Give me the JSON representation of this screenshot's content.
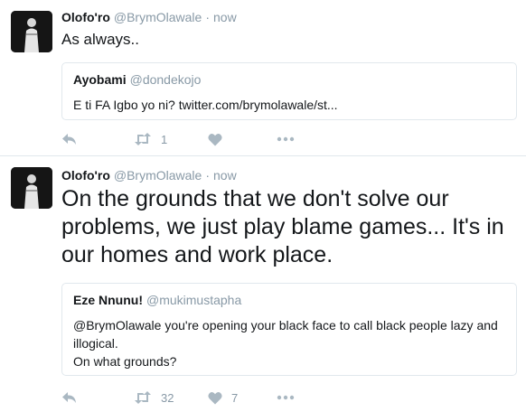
{
  "tweets": [
    {
      "author": {
        "name": "Olofo'ro",
        "handle": "@BrymOlawale"
      },
      "separator": "·",
      "time": "now",
      "text": "As always..",
      "quote": {
        "name": "Ayobami",
        "handle": "@dondekojo",
        "text": "E ti FA Igbo yo ni?  twitter.com/brymolawale/st..."
      },
      "actions": {
        "retweet_count": "1",
        "like_count": ""
      }
    },
    {
      "author": {
        "name": "Olofo'ro",
        "handle": "@BrymOlawale"
      },
      "separator": "·",
      "time": "now",
      "text": "On the grounds that we don't solve our problems, we just play blame games... It's in our homes and work place.",
      "quote": {
        "name": "Eze Nnunu!",
        "handle": "@mukimustapha",
        "text": "@BrymOlawale you're opening your black face to call black people lazy and illogical.\nOn what grounds?"
      },
      "actions": {
        "retweet_count": "32",
        "like_count": "7"
      }
    }
  ],
  "icons": {
    "reply": "reply-icon",
    "retweet": "retweet-icon",
    "like": "heart-icon",
    "more": "more-icon"
  },
  "colors": {
    "icon": "#aab8c2",
    "secondary_text": "#8899a6",
    "border": "#e1e8ed"
  }
}
